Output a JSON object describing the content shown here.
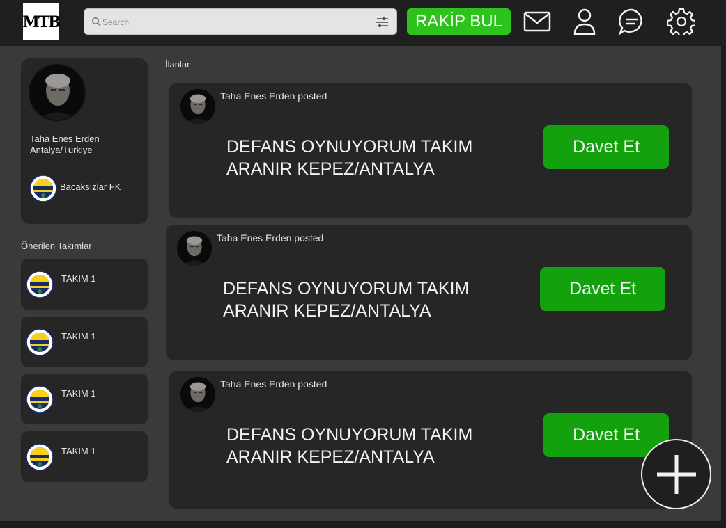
{
  "header": {
    "logo_text": "MTB",
    "search_placeholder": "Search",
    "rakip_label": "RAKİP BUL",
    "icons": [
      "mail-icon",
      "user-icon",
      "chat-icon",
      "gear-icon"
    ],
    "accent": "#2ec21d"
  },
  "profile": {
    "name": "Taha Enes Erden",
    "location": "Antalya/Türkiye",
    "team": "Bacaksızlar FK"
  },
  "suggested": {
    "label": "Önerilen Takımlar",
    "teams": [
      "TAKIM 1",
      "TAKIM 1",
      "TAKIM 1",
      "TAKIM 1"
    ]
  },
  "feed": {
    "label": "İlanlar",
    "posts": [
      {
        "author": "Taha Enes Erden posted",
        "text": "DEFANS OYNUYORUM TAKIM ARANIR KEPEZ/ANTALYA",
        "button": "Davet Et"
      },
      {
        "author": "Taha Enes Erden posted",
        "text": "DEFANS OYNUYORUM TAKIM ARANIR KEPEZ/ANTALYA",
        "button": "Davet Et"
      },
      {
        "author": "Taha Enes Erden posted",
        "text": "DEFANS OYNUYORUM TAKIM ARANIR KEPEZ/ANTALYA",
        "button": "Davet Et"
      }
    ],
    "button_color": "#13a10e"
  }
}
